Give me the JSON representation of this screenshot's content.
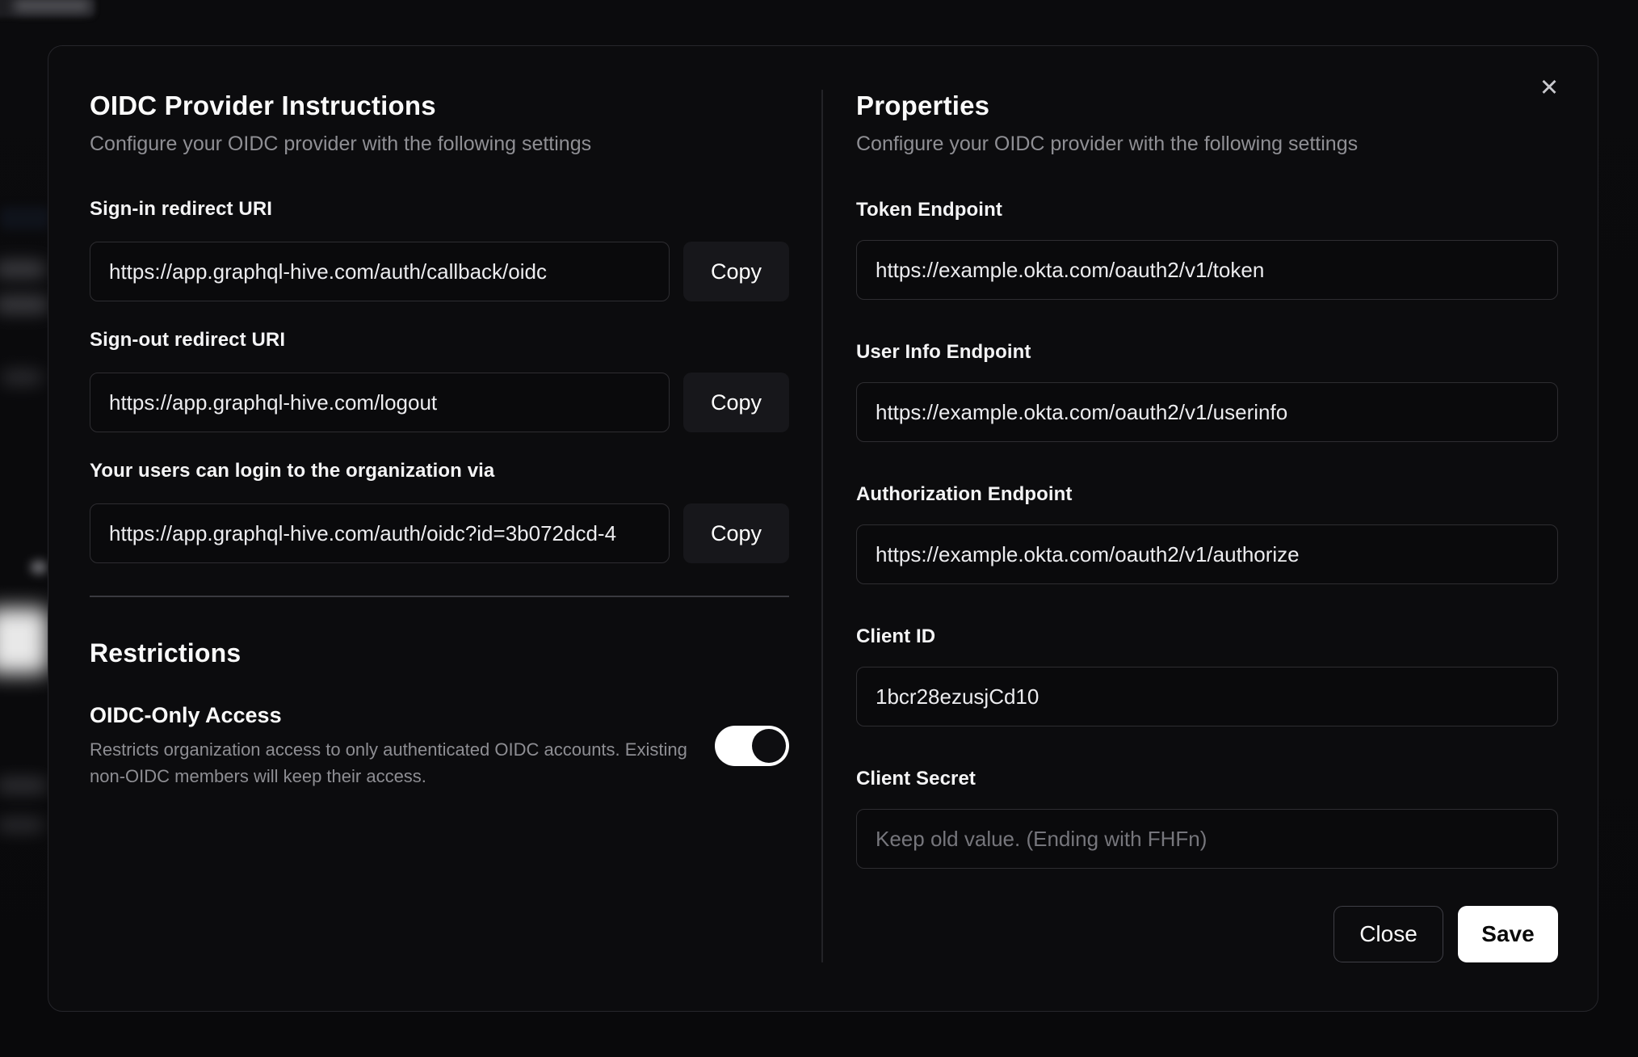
{
  "colors": {
    "page_bg": "#0a0a0b",
    "modal_bg": "#0c0c0e",
    "save_button_bg": "#ffffff",
    "toggle_track": "#ffffff",
    "divider": "#3a3a3f"
  },
  "modal": {
    "close_icon": "✕",
    "left_panel": {
      "title": "OIDC Provider Instructions",
      "subtitle": "Configure your OIDC provider with the following settings",
      "fields": [
        {
          "label": "Sign-in redirect URI",
          "value": "https://app.graphql-hive.com/auth/callback/oidc",
          "copy_label": "Copy"
        },
        {
          "label": "Sign-out redirect URI",
          "value": "https://app.graphql-hive.com/logout",
          "copy_label": "Copy"
        },
        {
          "label": "Your users can login to the organization via",
          "value": "https://app.graphql-hive.com/auth/oidc?id=3b072dcd-4",
          "copy_label": "Copy"
        }
      ],
      "restrictions": {
        "heading": "Restrictions",
        "toggle_label": "OIDC-Only Access",
        "toggle_description": "Restricts organization access to only authenticated OIDC accounts. Existing non-OIDC members will keep their access.",
        "toggle_state": "on"
      }
    },
    "right_panel": {
      "title": "Properties",
      "subtitle": "Configure your OIDC provider with the following settings",
      "fields": [
        {
          "label": "Token Endpoint",
          "value": "https://example.okta.com/oauth2/v1/token"
        },
        {
          "label": "User Info Endpoint",
          "value": "https://example.okta.com/oauth2/v1/userinfo"
        },
        {
          "label": "Authorization Endpoint",
          "value": "https://example.okta.com/oauth2/v1/authorize"
        },
        {
          "label": "Client ID",
          "value": "1bcr28ezusjCd10"
        },
        {
          "label": "Client Secret",
          "value": "",
          "placeholder": "Keep old value. (Ending with FHFn)"
        }
      ],
      "footer": {
        "close_label": "Close",
        "save_label": "Save"
      }
    }
  }
}
